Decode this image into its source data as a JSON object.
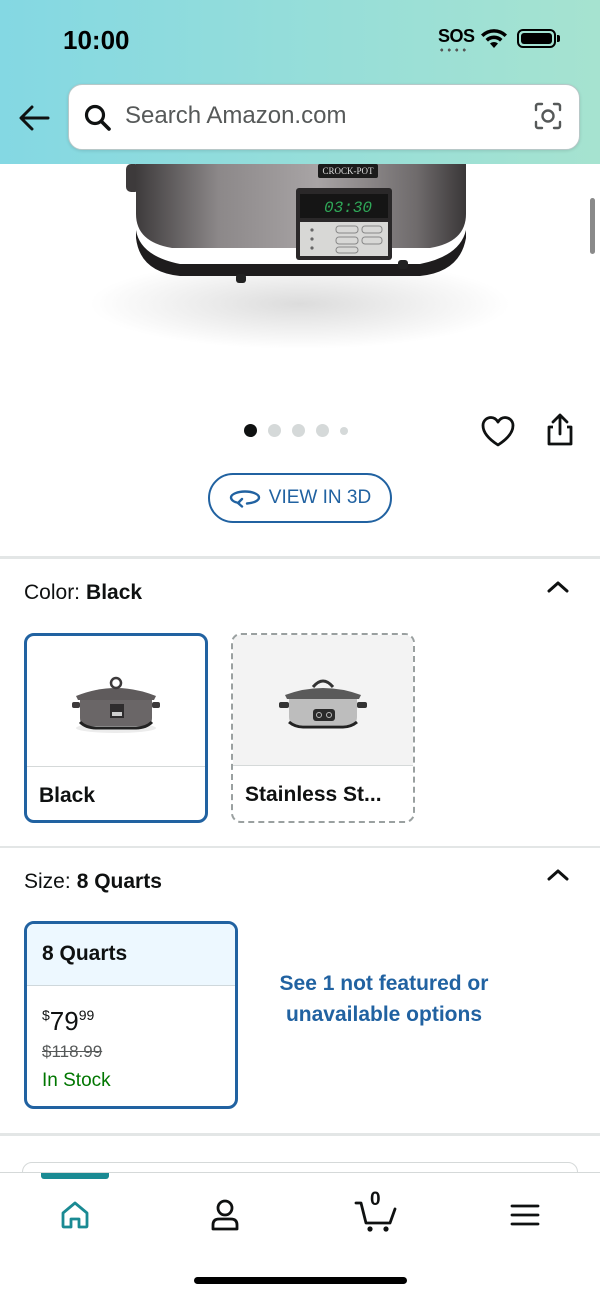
{
  "status_bar": {
    "time": "10:00",
    "sos": "SOS"
  },
  "search": {
    "placeholder": "Search Amazon.com"
  },
  "product_display": {
    "lcd_text": "03:30",
    "brand_text": "CROCK-POT"
  },
  "gallery": {
    "image_count": 5,
    "active_index": 0
  },
  "view_3d": {
    "label": "VIEW IN 3D"
  },
  "color_section": {
    "label": "Color:",
    "selected_value": "Black",
    "options": [
      {
        "label": "Black",
        "state": "selected"
      },
      {
        "label": "Stainless St...",
        "state": "unavailable"
      }
    ]
  },
  "size_section": {
    "label": "Size:",
    "selected_value": "8 Quarts",
    "option": {
      "title": "8 Quarts",
      "price_symbol": "$",
      "price_whole": "79",
      "price_fraction": "99",
      "list_price": "$118.99",
      "availability": "In Stock"
    },
    "see_more_text": "See 1 not featured or unavailable options"
  },
  "bottom_nav": {
    "items": [
      {
        "name": "home",
        "active": true
      },
      {
        "name": "account",
        "active": false
      },
      {
        "name": "cart",
        "active": false
      },
      {
        "name": "menu",
        "active": false
      }
    ],
    "cart_count": "0"
  },
  "colors": {
    "header_gradient_start": "#84d8e3",
    "header_gradient_end": "#a6e3d0",
    "link_blue": "#2162a1",
    "in_stock_green": "#007600",
    "nav_active": "#1a8a93"
  }
}
